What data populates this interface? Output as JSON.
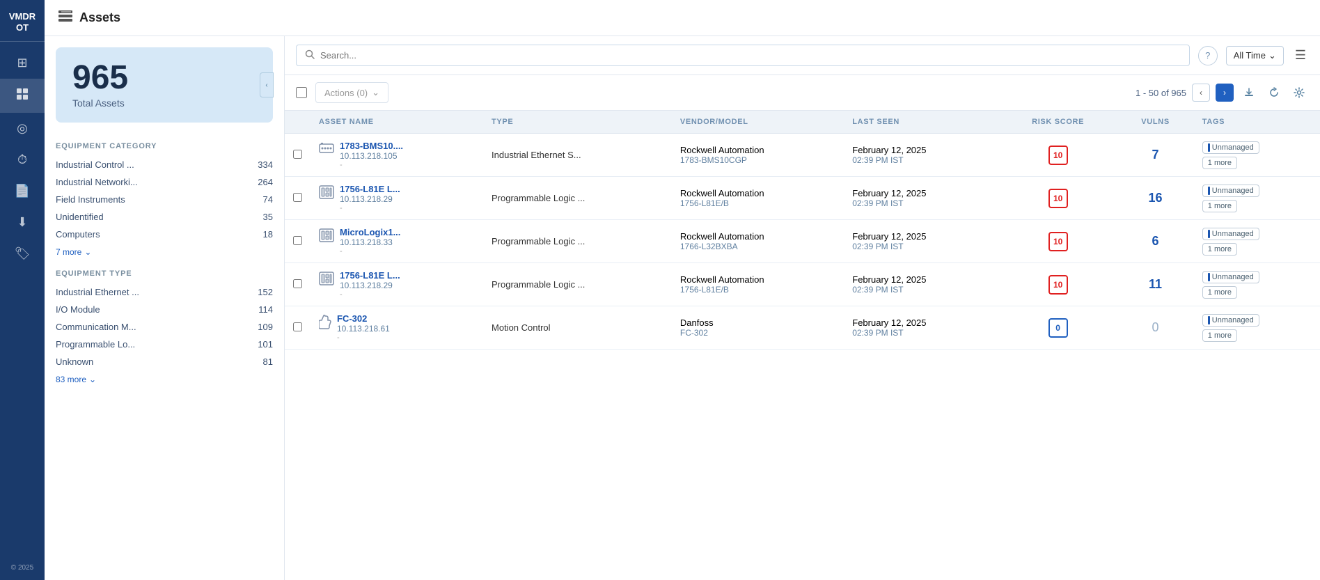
{
  "sidebar": {
    "logo": "VMDR\nOT",
    "items": [
      {
        "id": "dashboard",
        "icon": "⊞",
        "active": false
      },
      {
        "id": "assets",
        "icon": "🖥",
        "active": true
      },
      {
        "id": "globe",
        "icon": "◎",
        "active": false
      },
      {
        "id": "history",
        "icon": "⏱",
        "active": false
      },
      {
        "id": "report",
        "icon": "📄",
        "active": false
      },
      {
        "id": "download",
        "icon": "⬇",
        "active": false
      },
      {
        "id": "tag",
        "icon": "🏷",
        "active": false
      }
    ],
    "footer": "© 2025"
  },
  "header": {
    "title": "Assets",
    "icon": "🖥"
  },
  "totalAssets": {
    "count": "965",
    "label": "Total Assets"
  },
  "equipmentCategory": {
    "title": "EQUIPMENT CATEGORY",
    "items": [
      {
        "label": "Industrial Control ...",
        "count": "334"
      },
      {
        "label": "Industrial Networki...",
        "count": "264"
      },
      {
        "label": "Field Instruments",
        "count": "74"
      },
      {
        "label": "Unidentified",
        "count": "35"
      },
      {
        "label": "Computers",
        "count": "18"
      }
    ],
    "moreLabel": "7 more",
    "moreCount": "7"
  },
  "equipmentType": {
    "title": "EQUIPMENT TYPE",
    "items": [
      {
        "label": "Industrial Ethernet ...",
        "count": "152"
      },
      {
        "label": "I/O Module",
        "count": "114"
      },
      {
        "label": "Communication M...",
        "count": "109"
      },
      {
        "label": "Programmable Lo...",
        "count": "101"
      },
      {
        "label": "Unknown",
        "count": "81"
      }
    ],
    "moreLabel": "83 more",
    "moreCount": "83"
  },
  "search": {
    "placeholder": "Search..."
  },
  "timeFilter": {
    "label": "All Time"
  },
  "toolbar": {
    "actionsLabel": "Actions (0)",
    "pagination": "1 - 50 of 965"
  },
  "tableHeaders": {
    "assetName": "ASSET NAME",
    "type": "TYPE",
    "vendorModel": "VENDOR/MODEL",
    "lastSeen": "LAST SEEN",
    "riskScore": "RISK SCORE",
    "vulns": "VULNS",
    "tags": "TAGS"
  },
  "rows": [
    {
      "id": "row1",
      "iconType": "switch",
      "assetName": "1783-BMS10....",
      "assetIp": "10.113.218.105",
      "assetNote": "-",
      "type": "Industrial Ethernet S...",
      "vendor": "Rockwell Automation",
      "model": "1783-BMS10CGP",
      "lastSeen": "February 12, 2025",
      "lastSeenTime": "02:39 PM IST",
      "riskScore": "10",
      "riskClass": "high",
      "vulns": "7",
      "vulnsClass": "normal",
      "tags": [
        "Unmanaged",
        "1 more"
      ]
    },
    {
      "id": "row2",
      "iconType": "plc",
      "assetName": "1756-L81E L...",
      "assetIp": "10.113.218.29",
      "assetNote": "-",
      "type": "Programmable Logic ...",
      "vendor": "Rockwell Automation",
      "model": "1756-L81E/B",
      "lastSeen": "February 12, 2025",
      "lastSeenTime": "02:39 PM IST",
      "riskScore": "10",
      "riskClass": "high",
      "vulns": "16",
      "vulnsClass": "normal",
      "tags": [
        "Unmanaged",
        "1 more"
      ]
    },
    {
      "id": "row3",
      "iconType": "plc",
      "assetName": "MicroLogix1...",
      "assetIp": "10.113.218.33",
      "assetNote": "-",
      "type": "Programmable Logic ...",
      "vendor": "Rockwell Automation",
      "model": "1766-L32BXBA",
      "lastSeen": "February 12, 2025",
      "lastSeenTime": "02:39 PM IST",
      "riskScore": "10",
      "riskClass": "high",
      "vulns": "6",
      "vulnsClass": "normal",
      "tags": [
        "Unmanaged",
        "1 more"
      ]
    },
    {
      "id": "row4",
      "iconType": "plc",
      "assetName": "1756-L81E L...",
      "assetIp": "10.113.218.29",
      "assetNote": "-",
      "type": "Programmable Logic ...",
      "vendor": "Rockwell Automation",
      "model": "1756-L81E/B",
      "lastSeen": "February 12, 2025",
      "lastSeenTime": "02:39 PM IST",
      "riskScore": "10",
      "riskClass": "high",
      "vulns": "11",
      "vulnsClass": "normal",
      "tags": [
        "Unmanaged",
        "1 more"
      ]
    },
    {
      "id": "row5",
      "iconType": "hand",
      "assetName": "FC-302",
      "assetIp": "10.113.218.61",
      "assetNote": "-",
      "type": "Motion Control",
      "vendor": "Danfoss",
      "model": "FC-302",
      "lastSeen": "February 12, 2025",
      "lastSeenTime": "02:39 PM IST",
      "riskScore": "0",
      "riskClass": "zero",
      "vulns": "0",
      "vulnsClass": "zero",
      "tags": [
        "Unmanaged",
        "1 more"
      ]
    }
  ]
}
